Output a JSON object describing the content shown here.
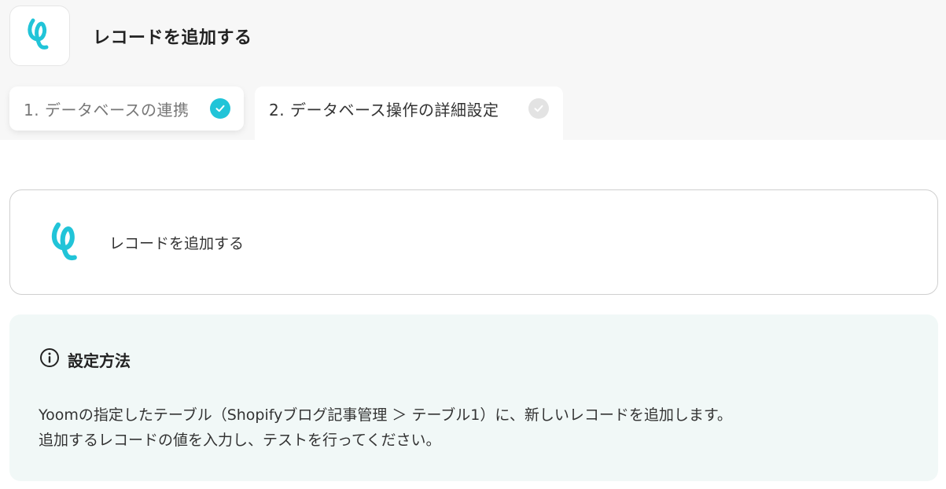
{
  "header": {
    "title": "レコードを追加する",
    "logo_icon": "yoom-logo-icon"
  },
  "steps": [
    {
      "label": "1. データベースの連携",
      "status": "completed",
      "status_icon": "check-circle-icon",
      "icon_color": "#21c4d8"
    },
    {
      "label": "2. データベース操作の詳細設定",
      "status": "current",
      "status_icon": "check-circle-icon",
      "icon_color": "#e3e3e3"
    }
  ],
  "action_card": {
    "label": "レコードを追加する",
    "logo_icon": "yoom-logo-icon"
  },
  "info": {
    "icon": "info-icon",
    "title": "設定方法",
    "line1": "Yoomの指定したテーブル（Shopifyブログ記事管理 ＞ テーブル1）に、新しいレコードを追加します。",
    "line2": "追加するレコードの値を入力し、テストを行ってください。"
  },
  "colors": {
    "accent": "#21c4d8",
    "info_bg": "#f1f8f7",
    "header_bg": "#f7f7f7"
  }
}
